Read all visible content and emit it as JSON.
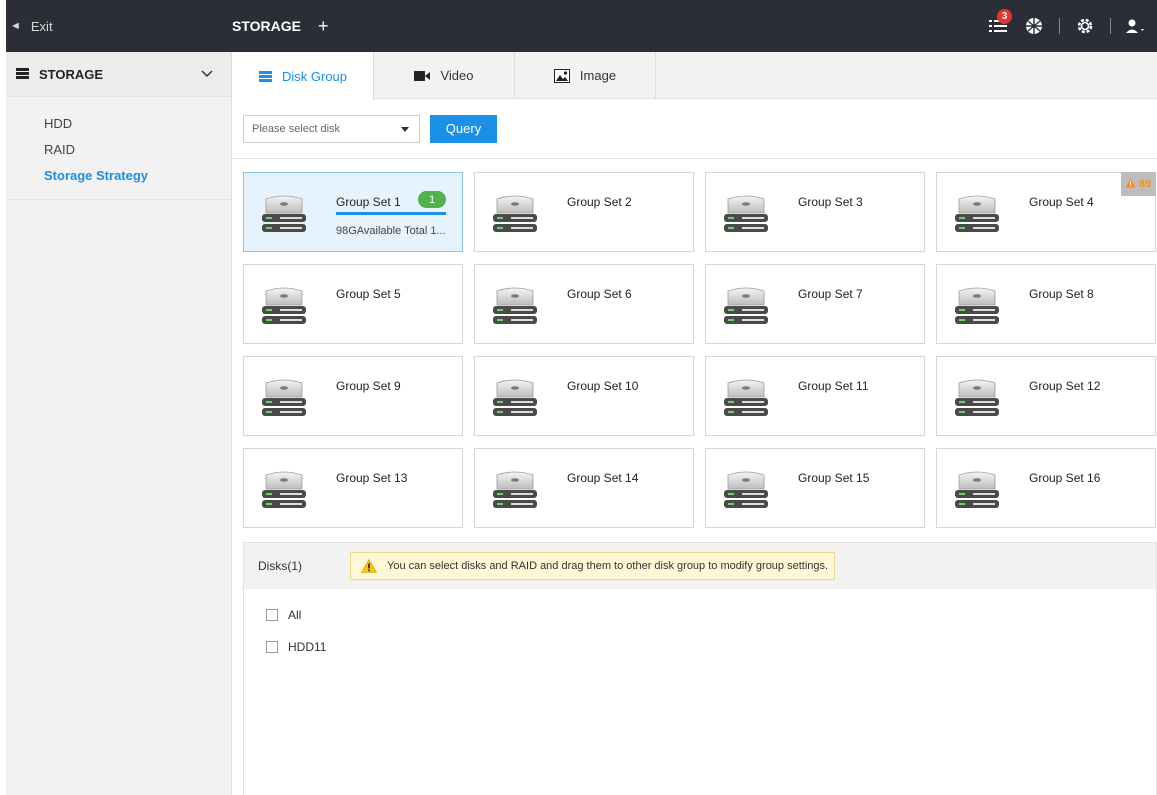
{
  "topbar": {
    "exit_label": "Exit",
    "tab_title": "STORAGE",
    "add_symbol": "+",
    "notifications_count": "3",
    "icons": [
      "task-list-icon",
      "globe-icon",
      "settings-icon",
      "user-icon"
    ]
  },
  "sidebar": {
    "title": "STORAGE",
    "items": [
      {
        "label": "HDD",
        "active": false
      },
      {
        "label": "RAID",
        "active": false
      },
      {
        "label": "Storage Strategy",
        "active": true
      }
    ]
  },
  "tabs": [
    {
      "label": "Disk Group",
      "active": true,
      "icon": "disk-group-icon"
    },
    {
      "label": "Video",
      "active": false,
      "icon": "video-icon"
    },
    {
      "label": "Image",
      "active": false,
      "icon": "image-icon"
    }
  ],
  "query": {
    "select_placeholder": "Please select disk",
    "button_label": "Query"
  },
  "groups": [
    {
      "title": "Group Set 1",
      "count": "1",
      "available": "98GAvailable Total 1...",
      "selected": true
    },
    {
      "title": "Group Set 2"
    },
    {
      "title": "Group Set 3"
    },
    {
      "title": "Group Set 4",
      "warning": "89"
    },
    {
      "title": "Group Set 5"
    },
    {
      "title": "Group Set 6"
    },
    {
      "title": "Group Set 7"
    },
    {
      "title": "Group Set 8"
    },
    {
      "title": "Group Set 9"
    },
    {
      "title": "Group Set 10"
    },
    {
      "title": "Group Set 11"
    },
    {
      "title": "Group Set 12"
    },
    {
      "title": "Group Set 13"
    },
    {
      "title": "Group Set 14"
    },
    {
      "title": "Group Set 15"
    },
    {
      "title": "Group Set 16"
    }
  ],
  "disks": {
    "header": "Disks(1)",
    "tip": "You can select disks and RAID and drag them to other disk group to modify group settings.",
    "items": [
      "All",
      "HDD11"
    ]
  },
  "colors": {
    "accent": "#1a90e6",
    "topbar": "#2b2e37",
    "count_badge": "#52b24e",
    "notification_badge": "#e63333",
    "warning": "#ff8c1a"
  }
}
